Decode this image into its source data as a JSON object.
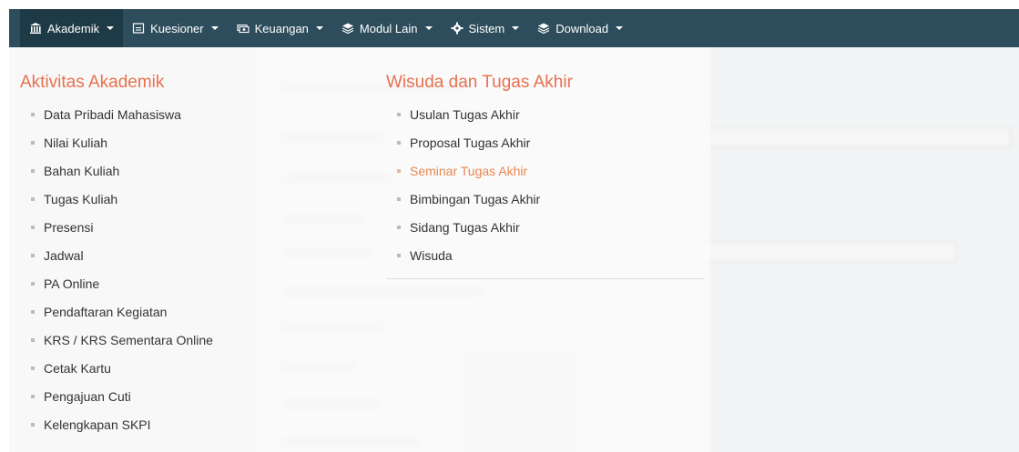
{
  "navbar": {
    "items": [
      {
        "label": "Akademik",
        "icon": "bank-icon",
        "active": true
      },
      {
        "label": "Kuesioner",
        "icon": "document-icon",
        "active": false
      },
      {
        "label": "Keuangan",
        "icon": "money-icon",
        "active": false
      },
      {
        "label": "Modul Lain",
        "icon": "layers-icon",
        "active": false
      },
      {
        "label": "Sistem",
        "icon": "gear-icon",
        "active": false
      },
      {
        "label": "Download",
        "icon": "layers-icon",
        "active": false
      }
    ]
  },
  "dropdown": {
    "akademik": {
      "title": "Aktivitas Akademik",
      "items": [
        "Data Pribadi Mahasiswa",
        "Nilai Kuliah",
        "Bahan Kuliah",
        "Tugas Kuliah",
        "Presensi",
        "Jadwal",
        "PA Online",
        "Pendaftaran Kegiatan",
        "KRS / KRS Sementara Online",
        "Cetak Kartu",
        "Pengajuan Cuti",
        "Kelengkapan SKPI"
      ]
    },
    "wisuda": {
      "title": "Wisuda dan Tugas Akhir",
      "items": [
        "Usulan Tugas Akhir",
        "Proposal Tugas Akhir",
        "Seminar Tugas Akhir",
        "Bimbingan Tugas Akhir",
        "Sidang Tugas Akhir",
        "Wisuda"
      ],
      "highlighted_index": 2
    }
  },
  "colors": {
    "navbar_bg": "#2e4d5c",
    "accent_title": "#e8704f",
    "highlight_text": "#e8864f"
  }
}
